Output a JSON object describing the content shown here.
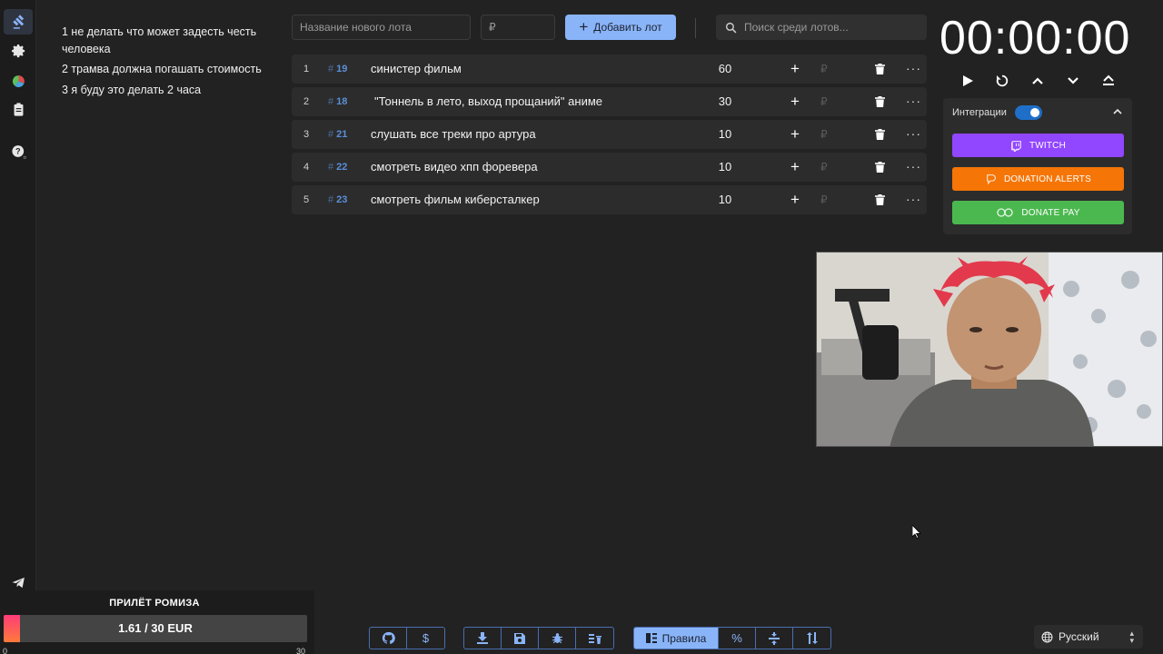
{
  "rules": [
    "1 не делать что может задесть честь человека",
    "2 трамва должна погашать стоимость",
    "3 я буду это делать 2 часа"
  ],
  "topbar": {
    "lot_name_placeholder": "Название нового лота",
    "amount_placeholder": "₽",
    "add_lot_label": "Добавить лот",
    "search_placeholder": "Поиск среди лотов..."
  },
  "lots": [
    {
      "position": "1",
      "id": "19",
      "name": "синистер фильм",
      "amount": "60"
    },
    {
      "position": "2",
      "id": "18",
      "name": "\"Тоннель в лето, выход прощаний\" аниме",
      "amount": "30"
    },
    {
      "position": "3",
      "id": "21",
      "name": "слушать все треки про артура",
      "amount": "10"
    },
    {
      "position": "4",
      "id": "22",
      "name": "смотреть видео хпп форевера",
      "amount": "10"
    },
    {
      "position": "5",
      "id": "23",
      "name": "смотреть фильм киберсталкер",
      "amount": "10"
    }
  ],
  "lot_actions": {
    "plus": "+",
    "currency": "₽",
    "more": "···"
  },
  "timer": {
    "value": "00:00:00"
  },
  "integrations": {
    "title": "Интеграции",
    "enabled": true,
    "buttons": [
      {
        "label": "TWITCH",
        "color": "#9146ff"
      },
      {
        "label": "DONATION ALERTS",
        "color": "#f57507"
      },
      {
        "label": "DONATE PAY",
        "color": "#4bb84f"
      }
    ]
  },
  "donation_goal": {
    "title": "ПРИЛЁТ РОМИЗА",
    "progress_text": "1.61 / 30 EUR",
    "progress_fraction": 0.054,
    "min_label": "0",
    "max_label": "30"
  },
  "bottom_toolbar": {
    "rules_label": "Правила",
    "percent_label": "%"
  },
  "language": {
    "selected": "Русский"
  },
  "colors": {
    "accent": "#8ab4f8",
    "background": "#222222",
    "row": "#2c2c2c"
  }
}
